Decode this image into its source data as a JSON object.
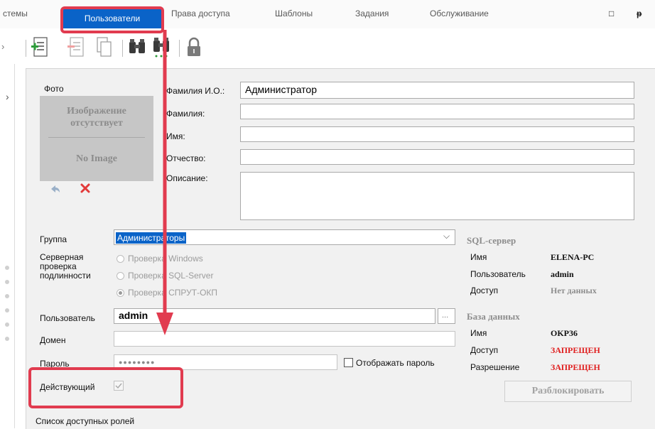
{
  "menu": {
    "items": [
      {
        "label": "стемы"
      },
      {
        "label": "Пользователи"
      },
      {
        "label": "Права доступа"
      },
      {
        "label": "Шаблоны"
      },
      {
        "label": "Задания"
      },
      {
        "label": "Обслуживание"
      }
    ],
    "active_index": 1,
    "restore_glyph": "□",
    "pin_glyph": "ᵽ"
  },
  "toolbar": {
    "icons": [
      "add-document-icon",
      "remove-document-icon",
      "copy-document-icon",
      "find-icon",
      "find-all-icon",
      "lock-icon"
    ]
  },
  "photo": {
    "label": "Фото",
    "placeholder_ru": "Изображение отсутствует",
    "placeholder_en": "No Image"
  },
  "user_form": {
    "full_name_label": "Фамилия И.О.:",
    "full_name_value": "Администратор",
    "last_name_label": "Фамилия:",
    "last_name_value": "",
    "first_name_label": "Имя:",
    "first_name_value": "",
    "middle_name_label": "Отчество:",
    "middle_name_value": "",
    "description_label": "Описание:",
    "description_value": ""
  },
  "group": {
    "label": "Группа",
    "selected": "Администраторы"
  },
  "auth": {
    "label": "Серверная проверка подлинности",
    "options": [
      {
        "label": "Проверка Windows",
        "selected": false
      },
      {
        "label": "Проверка SQL-Server",
        "selected": false
      },
      {
        "label": "Проверка СПРУТ-ОКП",
        "selected": true
      }
    ]
  },
  "login": {
    "user_label": "Пользователь",
    "user_value": "admin",
    "browse_label": "...",
    "domain_label": "Домен",
    "domain_value": "",
    "password_label": "Пароль",
    "password_value": "●●●●●●●●",
    "show_password_label": "Отображать пароль",
    "active_label": "Действующий",
    "active_checked": true
  },
  "sql_server": {
    "title": "SQL-сервер",
    "rows": [
      {
        "label": "Имя",
        "value": "ELENA-PC",
        "color": "#111111"
      },
      {
        "label": "Пользователь",
        "value": "admin",
        "color": "#111111"
      },
      {
        "label": "Доступ",
        "value": "Нет данных",
        "color": "#8d8d8d"
      }
    ]
  },
  "database": {
    "title": "База данных",
    "rows": [
      {
        "label": "Имя",
        "value": "OKP36",
        "color": "#111111"
      },
      {
        "label": "Доступ",
        "value": "ЗАПРЕЩЕН",
        "color": "#e02020"
      },
      {
        "label": "Разрешение",
        "value": "ЗАПРЕЩЕН",
        "color": "#e02020"
      }
    ]
  },
  "unlock_label": "Разблокировать",
  "roles_label": "Список доступных ролей",
  "annotation_color": "#e13b4f"
}
